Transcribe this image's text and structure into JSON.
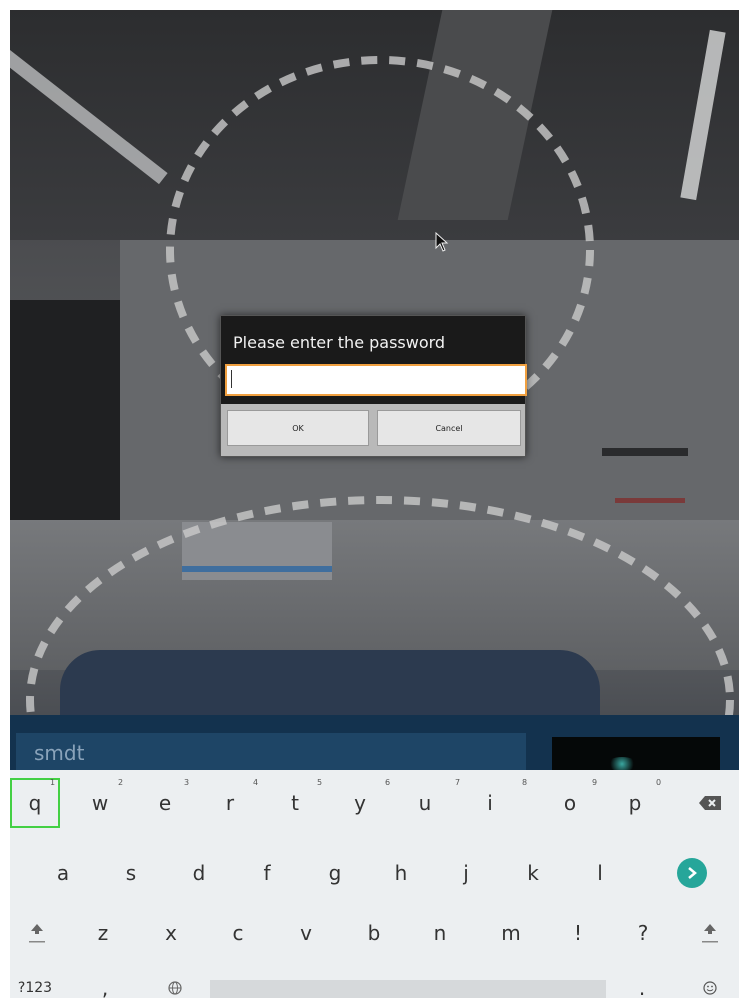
{
  "dialog": {
    "title": "Please enter the password",
    "password_value": "",
    "ok_label": "OK",
    "cancel_label": "Cancel"
  },
  "input_bar": {
    "field_text": "smdt"
  },
  "keyboard": {
    "row1": [
      {
        "label": "q",
        "hint": "1"
      },
      {
        "label": "w",
        "hint": "2"
      },
      {
        "label": "e",
        "hint": "3"
      },
      {
        "label": "r",
        "hint": "4"
      },
      {
        "label": "t",
        "hint": "5"
      },
      {
        "label": "y",
        "hint": "6"
      },
      {
        "label": "u",
        "hint": "7"
      },
      {
        "label": "i",
        "hint": "8"
      },
      {
        "label": "o",
        "hint": "9"
      },
      {
        "label": "p",
        "hint": "0"
      }
    ],
    "row2": [
      "a",
      "s",
      "d",
      "f",
      "g",
      "h",
      "j",
      "k",
      "l"
    ],
    "row3": [
      "z",
      "x",
      "c",
      "v",
      "b",
      "n",
      "m",
      "!",
      "?"
    ],
    "symbols_label": "?123",
    "comma_label": ",",
    "period_label": ".",
    "icons": {
      "backspace": "backspace-icon",
      "go": "go-arrow-icon",
      "shift": "shift-icon",
      "globe": "globe-icon",
      "emoji": "emoji-icon"
    },
    "accent_color": "#26a69a",
    "focus_color": "#44d044"
  }
}
